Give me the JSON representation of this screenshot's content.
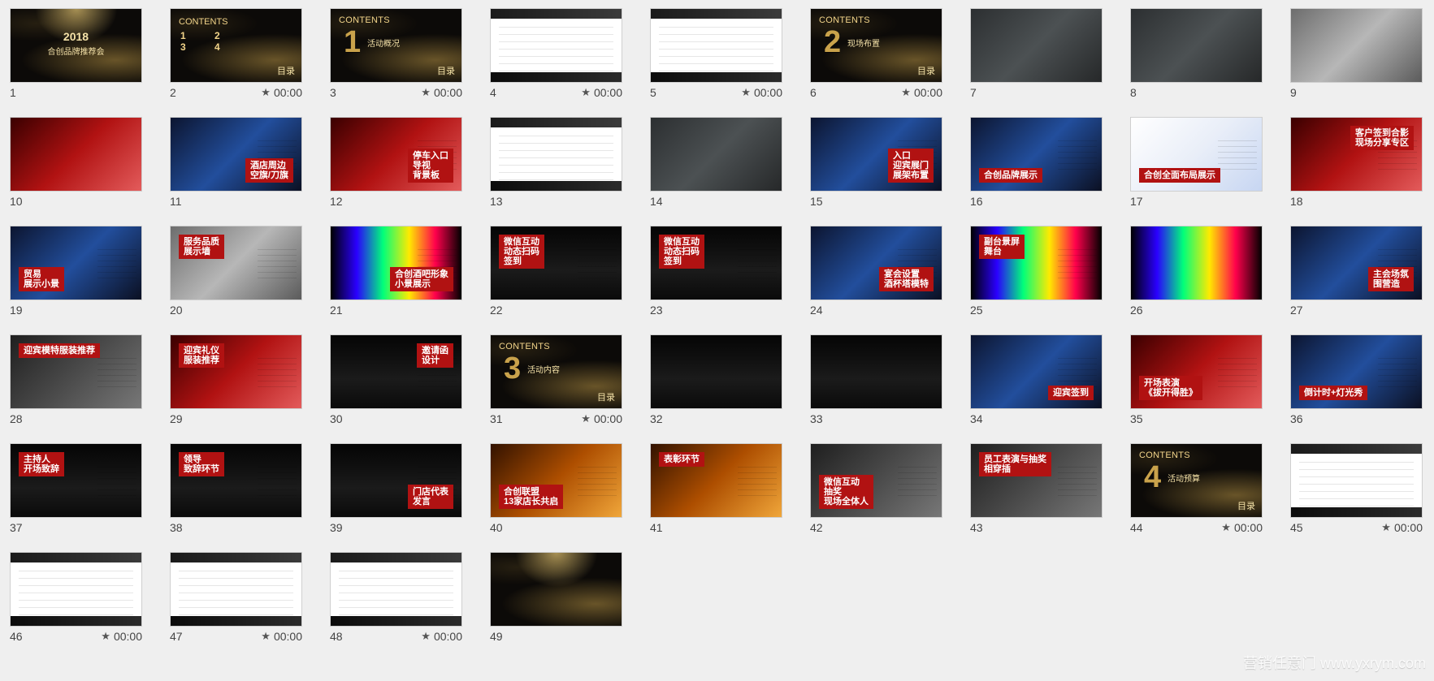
{
  "watermark": "营销任意门 www.yxrym.com",
  "slides": [
    {
      "num": "1",
      "timing": "",
      "variant": "cover",
      "caption": "",
      "title": "2018",
      "subtitle": "合创品牌推荐会"
    },
    {
      "num": "2",
      "timing": "00:00",
      "variant": "contents",
      "caption": "",
      "title": "CONTENTS",
      "subtitle": "目录"
    },
    {
      "num": "3",
      "timing": "00:00",
      "variant": "section",
      "caption": "",
      "title": "CONTENTS",
      "big": "1",
      "subtitle": "活动概况",
      "menu": "目录"
    },
    {
      "num": "4",
      "timing": "00:00",
      "variant": "text",
      "caption": ""
    },
    {
      "num": "5",
      "timing": "00:00",
      "variant": "text",
      "caption": ""
    },
    {
      "num": "6",
      "timing": "00:00",
      "variant": "section",
      "caption": "",
      "title": "CONTENTS",
      "big": "2",
      "subtitle": "现场布置",
      "menu": "目录"
    },
    {
      "num": "7",
      "timing": "",
      "variant": "map",
      "caption": ""
    },
    {
      "num": "8",
      "timing": "",
      "variant": "map",
      "caption": ""
    },
    {
      "num": "9",
      "timing": "",
      "variant": "photo",
      "photo": "ph-gray",
      "caption": ""
    },
    {
      "num": "10",
      "timing": "",
      "variant": "photo",
      "photo": "ph-red",
      "caption": ""
    },
    {
      "num": "11",
      "timing": "",
      "variant": "photo-label",
      "photo": "ph-blue",
      "caption": "酒店周边\n空旗/刀旗",
      "label_pos": "br"
    },
    {
      "num": "12",
      "timing": "",
      "variant": "photo-label",
      "photo": "ph-red",
      "caption": "停车入口\n导视\n背景板",
      "label_pos": "br"
    },
    {
      "num": "13",
      "timing": "",
      "variant": "text",
      "caption": ""
    },
    {
      "num": "14",
      "timing": "",
      "variant": "photo",
      "photo": "ph-map",
      "caption": ""
    },
    {
      "num": "15",
      "timing": "",
      "variant": "photo-label",
      "photo": "ph-blue",
      "caption": "入口\n迎宾展门\n展架布置",
      "label_pos": "br"
    },
    {
      "num": "16",
      "timing": "",
      "variant": "photo-label",
      "photo": "ph-blue",
      "caption": "合创品牌展示",
      "label_pos": "bl"
    },
    {
      "num": "17",
      "timing": "",
      "variant": "photo-label",
      "photo": "ph-white-mix",
      "caption": "合创全面布局展示",
      "label_pos": "bl"
    },
    {
      "num": "18",
      "timing": "",
      "variant": "photo-label",
      "photo": "ph-red",
      "caption": "客户签到合影\n现场分享专区",
      "label_pos": "tr"
    },
    {
      "num": "19",
      "timing": "",
      "variant": "photo-label",
      "photo": "ph-blue",
      "caption": "贸易\n展示小景",
      "label_pos": "bl"
    },
    {
      "num": "20",
      "timing": "",
      "variant": "photo-label",
      "photo": "ph-gray",
      "caption": "服务品质\n展示墙",
      "label_pos": "tl"
    },
    {
      "num": "21",
      "timing": "",
      "variant": "photo-label",
      "photo": "ph-rainbow",
      "caption": "合创酒吧形象\n小景展示",
      "label_pos": "br"
    },
    {
      "num": "22",
      "timing": "",
      "variant": "photo-label",
      "photo": "ph-stage",
      "caption": "微信互动\n动态扫码\n签到",
      "label_pos": "tl"
    },
    {
      "num": "23",
      "timing": "",
      "variant": "photo-label",
      "photo": "ph-stage",
      "caption": "微信互动\n动态扫码\n签到",
      "label_pos": "tl"
    },
    {
      "num": "24",
      "timing": "",
      "variant": "photo-label",
      "photo": "ph-blue",
      "caption": "宴会设置\n酒杯塔模特",
      "label_pos": "br"
    },
    {
      "num": "25",
      "timing": "",
      "variant": "photo-label",
      "photo": "ph-rainbow",
      "caption": "副台景屏\n舞台",
      "label_pos": "tl"
    },
    {
      "num": "26",
      "timing": "",
      "variant": "photo",
      "photo": "ph-rainbow",
      "caption": ""
    },
    {
      "num": "27",
      "timing": "",
      "variant": "photo-label",
      "photo": "ph-blue",
      "caption": "主会场氛\n围营造",
      "label_pos": "br"
    },
    {
      "num": "28",
      "timing": "",
      "variant": "photo-label",
      "photo": "ph-crowd",
      "caption": "迎宾模特服装推荐",
      "label_pos": "tl"
    },
    {
      "num": "29",
      "timing": "",
      "variant": "photo-label",
      "photo": "ph-red",
      "caption": "迎宾礼仪\n服装推荐",
      "label_pos": "tl"
    },
    {
      "num": "30",
      "timing": "",
      "variant": "photo-label",
      "photo": "ph-stage",
      "caption": "邀请函\n设计",
      "label_pos": "tr"
    },
    {
      "num": "31",
      "timing": "00:00",
      "variant": "section",
      "caption": "",
      "title": "CONTENTS",
      "big": "3",
      "subtitle": "活动内容",
      "menu": "目录"
    },
    {
      "num": "32",
      "timing": "",
      "variant": "photo",
      "photo": "ph-stage",
      "caption": ""
    },
    {
      "num": "33",
      "timing": "",
      "variant": "photo",
      "photo": "ph-stage",
      "caption": ""
    },
    {
      "num": "34",
      "timing": "",
      "variant": "photo-label",
      "photo": "ph-blue",
      "caption": "迎宾签到",
      "label_pos": "br"
    },
    {
      "num": "35",
      "timing": "",
      "variant": "photo-label",
      "photo": "ph-red",
      "caption": "开场表演\n《拔开得胜》",
      "label_pos": "bl"
    },
    {
      "num": "36",
      "timing": "",
      "variant": "photo-label",
      "photo": "ph-blue",
      "caption": "倒计时+灯光秀",
      "label_pos": "bl"
    },
    {
      "num": "37",
      "timing": "",
      "variant": "photo-label",
      "photo": "ph-stage",
      "caption": "主持人\n开场致辞",
      "label_pos": "tl"
    },
    {
      "num": "38",
      "timing": "",
      "variant": "photo-label",
      "photo": "ph-stage",
      "caption": "领导\n致辞环节",
      "label_pos": "tl"
    },
    {
      "num": "39",
      "timing": "",
      "variant": "photo-label",
      "photo": "ph-stage",
      "caption": "门店代表\n发言",
      "label_pos": "br"
    },
    {
      "num": "40",
      "timing": "",
      "variant": "photo-label",
      "photo": "ph-warm",
      "caption": "合创联盟\n13家店长共启",
      "label_pos": "bl"
    },
    {
      "num": "41",
      "timing": "",
      "variant": "photo-label",
      "photo": "ph-warm",
      "caption": "表彰环节",
      "label_pos": "tl"
    },
    {
      "num": "42",
      "timing": "",
      "variant": "photo-label",
      "photo": "ph-crowd",
      "caption": "微信互动\n抽奖\n现场全体人",
      "label_pos": "bl"
    },
    {
      "num": "43",
      "timing": "",
      "variant": "photo-label",
      "photo": "ph-crowd",
      "caption": "员工表演与抽奖\n相穿插",
      "label_pos": "tl"
    },
    {
      "num": "44",
      "timing": "00:00",
      "variant": "section",
      "caption": "",
      "title": "CONTENTS",
      "big": "4",
      "subtitle": "活动预算",
      "menu": "目录"
    },
    {
      "num": "45",
      "timing": "00:00",
      "variant": "text",
      "caption": ""
    },
    {
      "num": "46",
      "timing": "00:00",
      "variant": "text",
      "caption": ""
    },
    {
      "num": "47",
      "timing": "00:00",
      "variant": "text",
      "caption": ""
    },
    {
      "num": "48",
      "timing": "00:00",
      "variant": "text",
      "caption": ""
    },
    {
      "num": "49",
      "timing": "",
      "variant": "ending",
      "caption": ""
    }
  ]
}
